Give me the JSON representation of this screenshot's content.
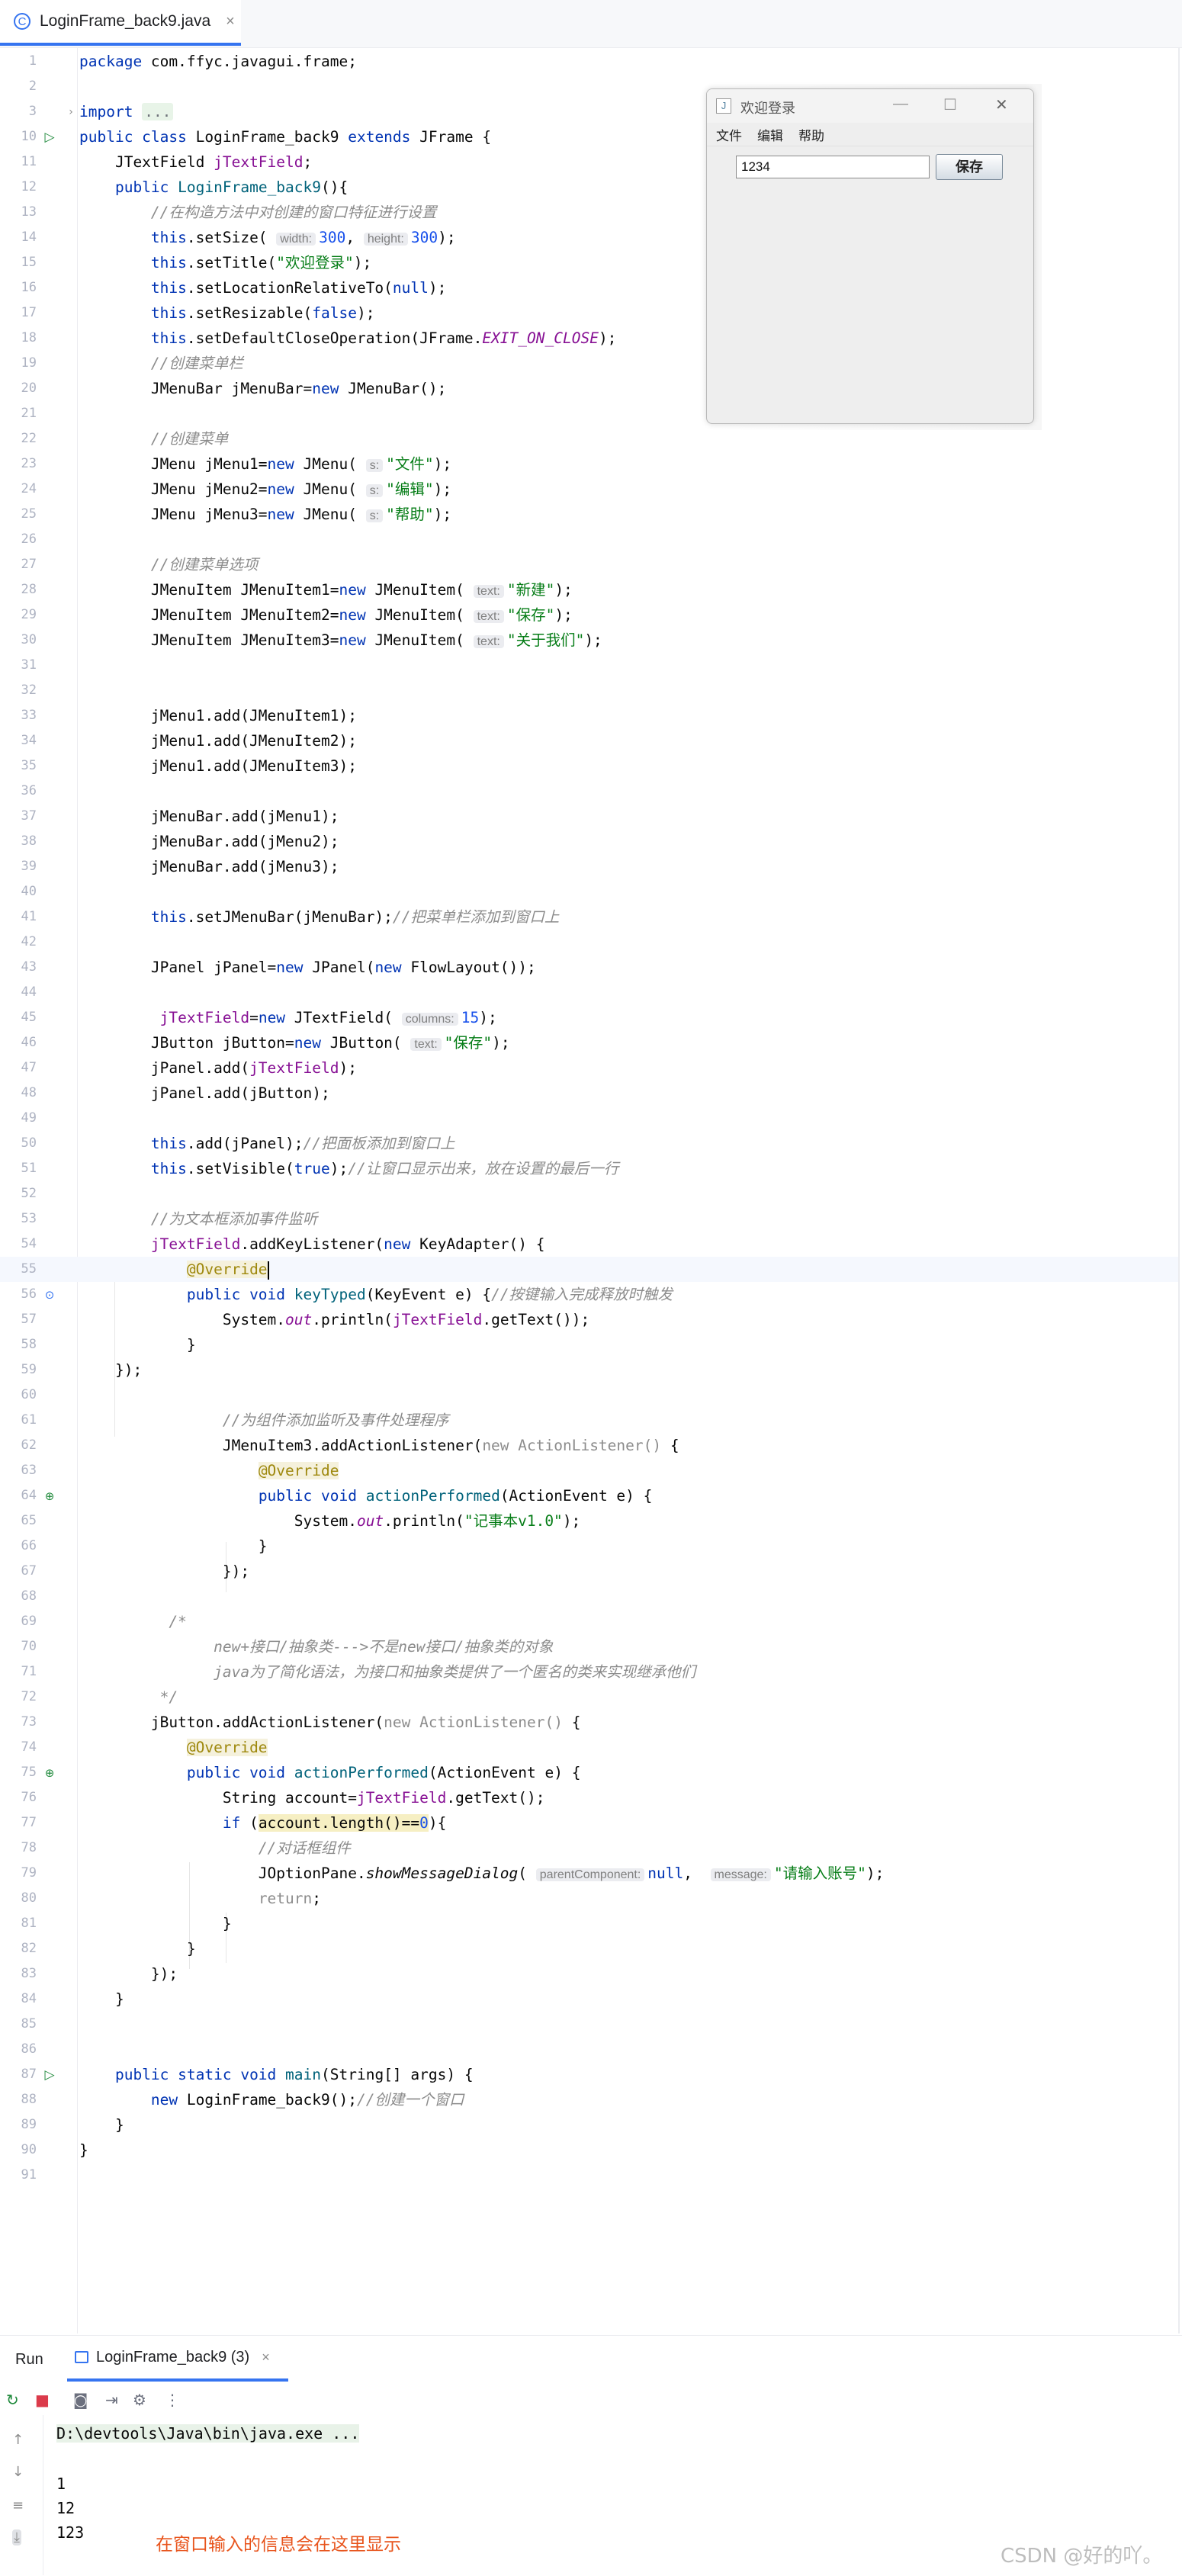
{
  "tab": {
    "filename": "LoginFrame_back9.java",
    "close": "×",
    "icon": "C"
  },
  "editor": {
    "lines": [
      {
        "n": "1",
        "html": "<span class=\"kw\">package</span> com.ffyc.javagui.frame;"
      },
      {
        "n": "2",
        "html": ""
      },
      {
        "n": "3",
        "html": "<span class=\"kw\">import</span> <span class=\"fold-box\">...</span>",
        "fold": true
      },
      {
        "n": "10",
        "html": "<span class=\"kw\">public class</span> LoginFrame_back9 <span class=\"kw\">extends</span> JFrame {",
        "icon": "run"
      },
      {
        "n": "11",
        "html": "    JTextField <span class=\"fld\">jTextField</span>;"
      },
      {
        "n": "12",
        "html": "    <span class=\"kw\">public</span> <span class=\"meth\">LoginFrame_back9</span>(){"
      },
      {
        "n": "13",
        "html": "        <span class=\"cmt\">//在构造方法中对创建的窗口特征进行设置</span>"
      },
      {
        "n": "14",
        "html": "        <span class=\"kw\">this</span>.setSize( <span class=\"hint\">width:</span><span class=\"num\">300</span>, <span class=\"hint\">height:</span><span class=\"num\">300</span>);"
      },
      {
        "n": "15",
        "html": "        <span class=\"kw\">this</span>.setTitle(<span class=\"str\">\"欢迎登录\"</span>);"
      },
      {
        "n": "16",
        "html": "        <span class=\"kw\">this</span>.setLocationRelativeTo(<span class=\"kw\">null</span>);"
      },
      {
        "n": "17",
        "html": "        <span class=\"kw\">this</span>.setResizable(<span class=\"kw\">false</span>);"
      },
      {
        "n": "18",
        "html": "        <span class=\"kw\">this</span>.setDefaultCloseOperation(JFrame.<span class=\"sta\">EXIT_ON_CLOSE</span>);"
      },
      {
        "n": "19",
        "html": "        <span class=\"cmt\">//创建菜单栏</span>"
      },
      {
        "n": "20",
        "html": "        JMenuBar jMenuBar=<span class=\"kw\">new</span> JMenuBar();"
      },
      {
        "n": "21",
        "html": ""
      },
      {
        "n": "22",
        "html": "        <span class=\"cmt\">//创建菜单</span>"
      },
      {
        "n": "23",
        "html": "        JMenu jMenu1=<span class=\"kw\">new</span> JMenu( <span class=\"hint\">s:</span><span class=\"str\">\"文件\"</span>);"
      },
      {
        "n": "24",
        "html": "        JMenu jMenu2=<span class=\"kw\">new</span> JMenu( <span class=\"hint\">s:</span><span class=\"str\">\"编辑\"</span>);"
      },
      {
        "n": "25",
        "html": "        JMenu jMenu3=<span class=\"kw\">new</span> JMenu( <span class=\"hint\">s:</span><span class=\"str\">\"帮助\"</span>);"
      },
      {
        "n": "26",
        "html": ""
      },
      {
        "n": "27",
        "html": "        <span class=\"cmt\">//创建菜单选项</span>"
      },
      {
        "n": "28",
        "html": "        JMenuItem JMenuItem1=<span class=\"kw\">new</span> JMenuItem( <span class=\"hint\">text:</span><span class=\"str\">\"新建\"</span>);"
      },
      {
        "n": "29",
        "html": "        JMenuItem JMenuItem2=<span class=\"kw\">new</span> JMenuItem( <span class=\"hint\">text:</span><span class=\"str\">\"保存\"</span>);"
      },
      {
        "n": "30",
        "html": "        JMenuItem JMenuItem3=<span class=\"kw\">new</span> JMenuItem( <span class=\"hint\">text:</span><span class=\"str\">\"关于我们\"</span>);"
      },
      {
        "n": "31",
        "html": ""
      },
      {
        "n": "32",
        "html": ""
      },
      {
        "n": "33",
        "html": "        jMenu1.add(JMenuItem1);"
      },
      {
        "n": "34",
        "html": "        jMenu1.add(JMenuItem2);"
      },
      {
        "n": "35",
        "html": "        jMenu1.add(JMenuItem3);"
      },
      {
        "n": "36",
        "html": ""
      },
      {
        "n": "37",
        "html": "        jMenuBar.add(jMenu1);"
      },
      {
        "n": "38",
        "html": "        jMenuBar.add(jMenu2);"
      },
      {
        "n": "39",
        "html": "        jMenuBar.add(jMenu3);"
      },
      {
        "n": "40",
        "html": ""
      },
      {
        "n": "41",
        "html": "        <span class=\"kw\">this</span>.setJMenuBar(jMenuBar);<span class=\"cmt\">//把菜单栏添加到窗口上</span>"
      },
      {
        "n": "42",
        "html": ""
      },
      {
        "n": "43",
        "html": "        JPanel jPanel=<span class=\"kw\">new</span> JPanel(<span class=\"kw\">new</span> FlowLayout());"
      },
      {
        "n": "44",
        "html": ""
      },
      {
        "n": "45",
        "html": "         <span class=\"fld\">jTextField</span>=<span class=\"kw\">new</span> JTextField( <span class=\"hint\">columns:</span><span class=\"num\">15</span>);"
      },
      {
        "n": "46",
        "html": "        JButton jButton=<span class=\"kw\">new</span> JButton( <span class=\"hint\">text:</span><span class=\"str\">\"保存\"</span>);"
      },
      {
        "n": "47",
        "html": "        jPanel.add(<span class=\"fld\">jTextField</span>);"
      },
      {
        "n": "48",
        "html": "        jPanel.add(jButton);"
      },
      {
        "n": "49",
        "html": ""
      },
      {
        "n": "50",
        "html": "        <span class=\"kw\">this</span>.add(jPanel);<span class=\"cmt\">//把面板添加到窗口上</span>"
      },
      {
        "n": "51",
        "html": "        <span class=\"kw\">this</span>.setVisible(<span class=\"kw\">true</span>);<span class=\"cmt\">//让窗口显示出来，放在设置的最后一行</span>"
      },
      {
        "n": "52",
        "html": ""
      },
      {
        "n": "53",
        "html": "        <span class=\"cmt\">//为文本框添加事件监听</span>"
      },
      {
        "n": "54",
        "html": "        <span class=\"fld\">jTextField</span>.addKeyListener(<span class=\"kw\">new</span> KeyAdapter() {"
      },
      {
        "n": "55",
        "html": "            <span class=\"ann\">@Override</span><span class=\"caret\"></span>",
        "current": true
      },
      {
        "n": "56",
        "html": "            <span class=\"kw\">public void</span> <span class=\"meth\">keyTyped</span>(KeyEvent e) {<span class=\"cmt\">//按键输入完成释放时触发</span>",
        "icon": "over"
      },
      {
        "n": "57",
        "html": "                System.<span class=\"sta\">out</span>.println(<span class=\"fld\">jTextField</span>.getText());"
      },
      {
        "n": "58",
        "html": "            }"
      },
      {
        "n": "59",
        "html": "    });"
      },
      {
        "n": "60",
        "html": ""
      },
      {
        "n": "61",
        "html": "                <span class=\"cmt\">//为组件添加监听及事件处理程序</span>"
      },
      {
        "n": "62",
        "html": "                JMenuItem3.addActionListener(<span class=\"gry\">new ActionListener()</span> {"
      },
      {
        "n": "63",
        "html": "                    <span class=\"ann\">@Override</span>"
      },
      {
        "n": "64",
        "html": "                    <span class=\"kw\">public void</span> <span class=\"meth\">actionPerformed</span>(ActionEvent e) {",
        "icon": "impl"
      },
      {
        "n": "65",
        "html": "                        System.<span class=\"sta\">out</span>.println(<span class=\"str\">\"记事本v1.0\"</span>);"
      },
      {
        "n": "66",
        "html": "                    }"
      },
      {
        "n": "67",
        "html": "                });"
      },
      {
        "n": "68",
        "html": ""
      },
      {
        "n": "69",
        "html": "          <span class=\"cmt\">/*</span>"
      },
      {
        "n": "70",
        "html": "               <span class=\"cmt\">new+接口/抽象类---&gt;不是new接口/抽象类的对象</span>"
      },
      {
        "n": "71",
        "html": "               <span class=\"cmt\">java为了简化语法，为接口和抽象类提供了一个匿名的类来实现继承他们</span>"
      },
      {
        "n": "72",
        "html": "         <span class=\"cmt\">*/</span>"
      },
      {
        "n": "73",
        "html": "        jButton.addActionListener(<span class=\"gry\">new ActionListener()</span> {"
      },
      {
        "n": "74",
        "html": "            <span class=\"ann\">@Override</span>"
      },
      {
        "n": "75",
        "html": "            <span class=\"kw\">public void</span> <span class=\"meth\">actionPerformed</span>(ActionEvent e) {",
        "icon": "impl"
      },
      {
        "n": "76",
        "html": "                String account=<span class=\"fld\">jTextField</span>.getText();"
      },
      {
        "n": "77",
        "html": "                <span class=\"kw\">if</span> (<span class=\"hl\">account.length()==<span class=\"num\">0</span></span>){"
      },
      {
        "n": "78",
        "html": "                    <span class=\"cmt\">//对话框组件</span>"
      },
      {
        "n": "79",
        "html": "                    JOptionPane.<span class=\"sta\" style=\"color:#080808\">showMessageDialog</span>( <span class=\"hint\">parentComponent:</span><span class=\"kw\">null</span>,  <span class=\"hint\">message:</span><span class=\"str\">\"请输入账号\"</span>);"
      },
      {
        "n": "80",
        "html": "                    <span class=\"gry\">return</span>;"
      },
      {
        "n": "81",
        "html": "                }"
      },
      {
        "n": "82",
        "html": "            }"
      },
      {
        "n": "83",
        "html": "        });"
      },
      {
        "n": "84",
        "html": "    }"
      },
      {
        "n": "85",
        "html": ""
      },
      {
        "n": "86",
        "html": ""
      },
      {
        "n": "87",
        "html": "    <span class=\"kw\">public static void</span> <span class=\"meth\">main</span>(String[] args) {",
        "icon": "run"
      },
      {
        "n": "88",
        "html": "        <span class=\"kw\">new</span> LoginFrame_back9();<span class=\"cmt\">//创建一个窗口</span>"
      },
      {
        "n": "89",
        "html": "    }"
      },
      {
        "n": "90",
        "html": "}"
      },
      {
        "n": "91",
        "html": ""
      }
    ]
  },
  "swing_window": {
    "title": "欢迎登录",
    "icon": "J",
    "menus": [
      "文件",
      "编辑",
      "帮助"
    ],
    "input_value": "1234",
    "button_label": "保存",
    "minimize": "—",
    "maximize": "☐",
    "close": "✕"
  },
  "run_panel": {
    "title": "Run",
    "tab_label": "LoginFrame_back9 (3)",
    "tab_close": "×",
    "command": "D:\\devtools\\Java\\bin\\java.exe ...",
    "output_lines": [
      "1",
      "12",
      "123"
    ],
    "annotation": "在窗口输入的信息会在这里显示"
  },
  "watermark": "CSDN @好的吖。"
}
